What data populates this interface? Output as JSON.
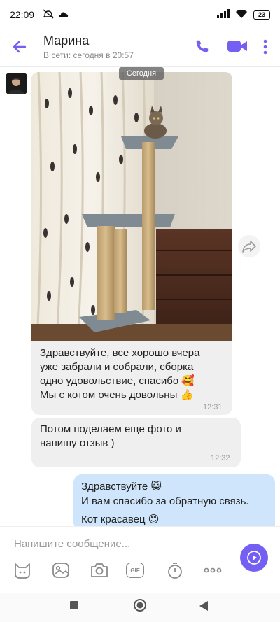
{
  "status_bar": {
    "time": "22:09",
    "battery": "23"
  },
  "header": {
    "title": "Марина",
    "subtitle": "В сети: сегодня в 20:57"
  },
  "date_label": "Сегодня",
  "messages": [
    {
      "direction": "incoming",
      "type": "photo_with_text",
      "lines": [
        "Здравствуйте, все хорошо   вчера",
        "уже забрали и собрали, сборка",
        "одно удовольствие, спасибо",
        "Мы с котом очень довольны"
      ],
      "emoji_after_line3": "🥰",
      "emoji_after_line4": "👍",
      "time": "12:31"
    },
    {
      "direction": "incoming",
      "type": "text",
      "lines": [
        "Потом поделаем еще фото и",
        "напишу отзыв )"
      ],
      "time": "12:32"
    },
    {
      "direction": "outgoing",
      "type": "text",
      "lines": [
        "Здравствуйте",
        "И вам спасибо за обратную связь.",
        "Кот красавец"
      ],
      "emoji_after_line1": "😺",
      "emoji_after_line3": "😍"
    }
  ],
  "composer": {
    "placeholder": "Напишите сообщение...",
    "toolbar": [
      "sticker-icon",
      "gallery-icon",
      "camera-icon",
      "gif-icon",
      "timer-icon",
      "more-icon"
    ],
    "gif_label": "GIF"
  },
  "colors": {
    "accent": "#7360f2",
    "incoming_bubble": "#efefef",
    "outgoing_bubble": "#cfe5fb"
  }
}
